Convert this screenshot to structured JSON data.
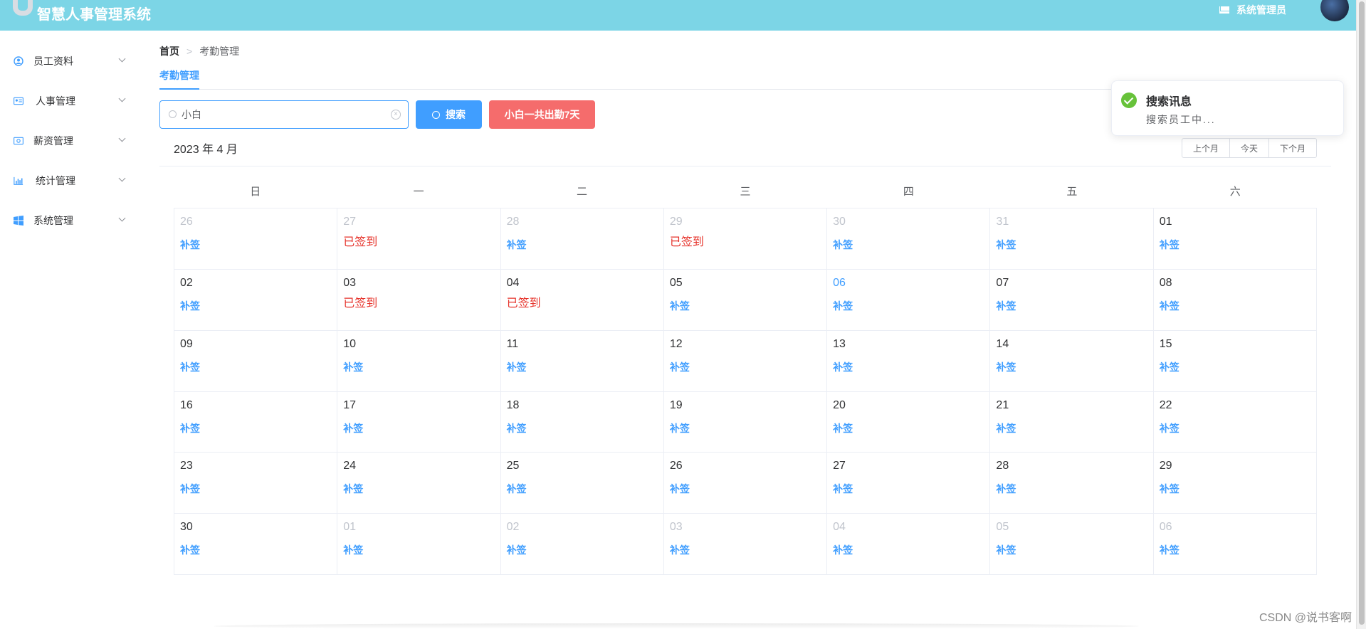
{
  "app": {
    "title": "智慧人事管理系统",
    "user": "系统管理员"
  },
  "sidebar": {
    "items": [
      {
        "label": "员工资料",
        "icon": "user-circle-icon"
      },
      {
        "label": "人事管理",
        "icon": "id-card-icon"
      },
      {
        "label": "薪资管理",
        "icon": "money-icon"
      },
      {
        "label": "统计管理",
        "icon": "bar-chart-icon"
      },
      {
        "label": "系统管理",
        "icon": "windows-icon"
      }
    ]
  },
  "breadcrumb": {
    "home": "首页",
    "separator": ">",
    "current": "考勤管理"
  },
  "tab": {
    "label": "考勤管理"
  },
  "search": {
    "value": "小白"
  },
  "buttons": {
    "search": "搜索",
    "count": "小白一共出勤7天"
  },
  "calendar": {
    "title": "2023 年 4 月",
    "nav": {
      "prev": "上个月",
      "today": "今天",
      "next": "下个月"
    },
    "weekdays": [
      "日",
      "一",
      "二",
      "三",
      "四",
      "五",
      "六"
    ],
    "cells": [
      {
        "day": "26",
        "other": true,
        "signed": false
      },
      {
        "day": "27",
        "other": true,
        "signed": true
      },
      {
        "day": "28",
        "other": true,
        "signed": false
      },
      {
        "day": "29",
        "other": true,
        "signed": true
      },
      {
        "day": "30",
        "other": true,
        "signed": false
      },
      {
        "day": "31",
        "other": true,
        "signed": false
      },
      {
        "day": "01",
        "other": false,
        "signed": false
      },
      {
        "day": "02",
        "other": false,
        "signed": false
      },
      {
        "day": "03",
        "other": false,
        "signed": true
      },
      {
        "day": "04",
        "other": false,
        "signed": true
      },
      {
        "day": "05",
        "other": false,
        "signed": false
      },
      {
        "day": "06",
        "other": false,
        "signed": false,
        "today": true
      },
      {
        "day": "07",
        "other": false,
        "signed": false
      },
      {
        "day": "08",
        "other": false,
        "signed": false
      },
      {
        "day": "09",
        "other": false,
        "signed": false
      },
      {
        "day": "10",
        "other": false,
        "signed": false
      },
      {
        "day": "11",
        "other": false,
        "signed": false
      },
      {
        "day": "12",
        "other": false,
        "signed": false
      },
      {
        "day": "13",
        "other": false,
        "signed": false
      },
      {
        "day": "14",
        "other": false,
        "signed": false
      },
      {
        "day": "15",
        "other": false,
        "signed": false
      },
      {
        "day": "16",
        "other": false,
        "signed": false
      },
      {
        "day": "17",
        "other": false,
        "signed": false
      },
      {
        "day": "18",
        "other": false,
        "signed": false
      },
      {
        "day": "19",
        "other": false,
        "signed": false
      },
      {
        "day": "20",
        "other": false,
        "signed": false
      },
      {
        "day": "21",
        "other": false,
        "signed": false
      },
      {
        "day": "22",
        "other": false,
        "signed": false
      },
      {
        "day": "23",
        "other": false,
        "signed": false
      },
      {
        "day": "24",
        "other": false,
        "signed": false
      },
      {
        "day": "25",
        "other": false,
        "signed": false
      },
      {
        "day": "26",
        "other": false,
        "signed": false
      },
      {
        "day": "27",
        "other": false,
        "signed": false
      },
      {
        "day": "28",
        "other": false,
        "signed": false
      },
      {
        "day": "29",
        "other": false,
        "signed": false
      },
      {
        "day": "30",
        "other": false,
        "signed": false
      },
      {
        "day": "01",
        "other": true,
        "signed": false
      },
      {
        "day": "02",
        "other": true,
        "signed": false
      },
      {
        "day": "03",
        "other": true,
        "signed": false
      },
      {
        "day": "04",
        "other": true,
        "signed": false
      },
      {
        "day": "05",
        "other": true,
        "signed": false
      },
      {
        "day": "06",
        "other": true,
        "signed": false
      }
    ],
    "signed_label": "已签到",
    "makeup_label": "补签"
  },
  "toast": {
    "title": "搜索讯息",
    "message": "搜索员工中..."
  },
  "watermark": "CSDN @说书客啊",
  "colors": {
    "header": "#7cd5e6",
    "primary": "#409eff",
    "danger": "#f56c6c",
    "signed": "#e6322a",
    "success": "#67c23a"
  }
}
